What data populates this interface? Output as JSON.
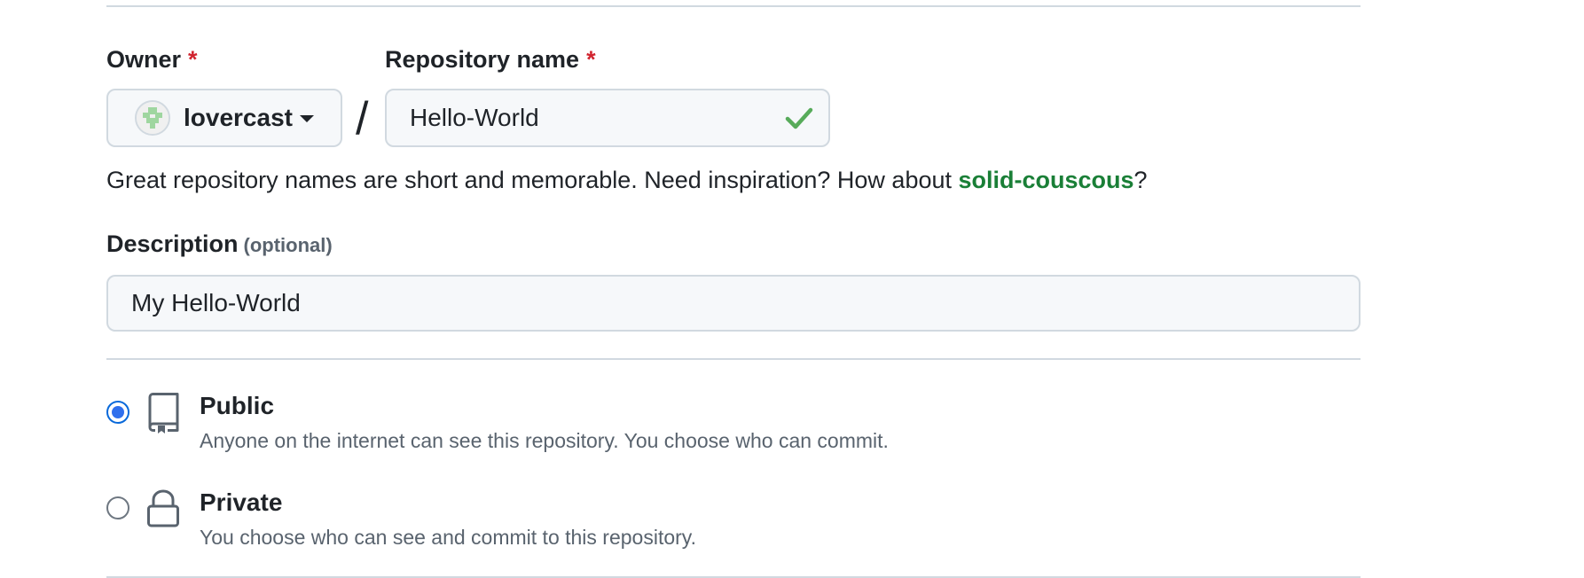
{
  "owner": {
    "label": "Owner",
    "required_mark": "*",
    "selected": "lovercast",
    "avatar": "identicon-avatar"
  },
  "repository": {
    "separator": "/",
    "label": "Repository name",
    "required_mark": "*",
    "value": "Hello-World",
    "status_icon": "check-icon",
    "hint_prefix": "Great repository names are short and memorable. Need inspiration? How about ",
    "suggestion": "solid-couscous",
    "hint_suffix": "?"
  },
  "description": {
    "label": "Description",
    "optional_note": "(optional)",
    "value": "My Hello-World"
  },
  "visibility": {
    "options": [
      {
        "title": "Public",
        "description": "Anyone on the internet can see this repository. You choose who can commit.",
        "icon": "repo-book-icon",
        "selected": true
      },
      {
        "title": "Private",
        "description": "You choose who can see and commit to this repository.",
        "icon": "lock-icon",
        "selected": false
      }
    ]
  },
  "colors": {
    "accent_blue": "#2f6fed",
    "required_red": "#d1242f",
    "success_green": "#1a7f37",
    "check_green": "#57ab5a",
    "muted_text": "#59636e",
    "border": "#d1d9e0"
  }
}
